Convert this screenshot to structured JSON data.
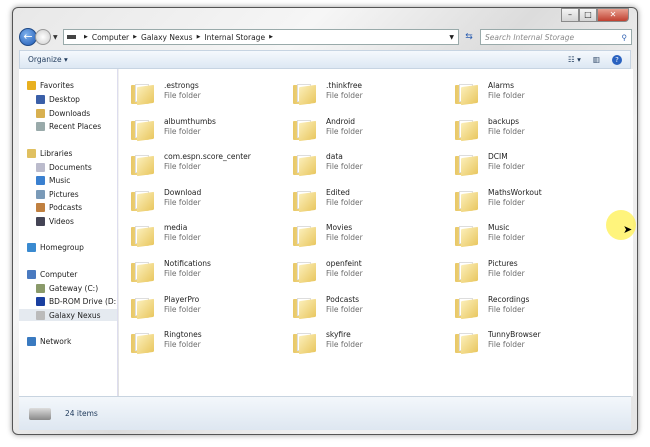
{
  "breadcrumb": [
    "Computer",
    "Galaxy Nexus",
    "Internal Storage"
  ],
  "search": {
    "placeholder": "Search Internal Storage"
  },
  "toolbar": {
    "organize": "Organize ▾"
  },
  "sidebar": [
    {
      "label": "Favorites",
      "icon": "star-icon",
      "color": "#e8b020",
      "level": 0
    },
    {
      "label": "Desktop",
      "icon": "desktop-icon",
      "color": "#3a5fa8",
      "level": 1
    },
    {
      "label": "Downloads",
      "icon": "downloads-icon",
      "color": "#d8b050",
      "level": 1
    },
    {
      "label": "Recent Places",
      "icon": "recent-places-icon",
      "color": "#9aa",
      "level": 1
    },
    {
      "label": "Libraries",
      "icon": "libraries-icon",
      "color": "#e0c060",
      "level": 0
    },
    {
      "label": "Documents",
      "icon": "documents-icon",
      "color": "#bbc",
      "level": 1
    },
    {
      "label": "Music",
      "icon": "music-icon",
      "color": "#3a80d0",
      "level": 1
    },
    {
      "label": "Pictures",
      "icon": "pictures-icon",
      "color": "#7a9ab8",
      "level": 1
    },
    {
      "label": "Podcasts",
      "icon": "podcasts-icon",
      "color": "#c08040",
      "level": 1
    },
    {
      "label": "Videos",
      "icon": "videos-icon",
      "color": "#445",
      "level": 1
    },
    {
      "label": "Homegroup",
      "icon": "homegroup-icon",
      "color": "#3a8ad0",
      "level": 0
    },
    {
      "label": "Computer",
      "icon": "computer-icon",
      "color": "#4a7ac0",
      "level": 0
    },
    {
      "label": "Gateway (C:)",
      "icon": "drive-icon",
      "color": "#8a9a6a",
      "level": 1
    },
    {
      "label": "BD-ROM Drive (D:) E",
      "icon": "bluetooth-icon",
      "color": "#1a3fa0",
      "level": 1
    },
    {
      "label": "Galaxy Nexus",
      "icon": "phone-icon",
      "color": "#bbb",
      "level": 1,
      "selected": true
    },
    {
      "label": "Network",
      "icon": "network-icon",
      "color": "#3a7ac0",
      "level": 0
    }
  ],
  "folders": [
    {
      "name": ".estrongs",
      "type": "File folder"
    },
    {
      "name": ".thinkfree",
      "type": "File folder"
    },
    {
      "name": "Alarms",
      "type": "File folder"
    },
    {
      "name": "albumthumbs",
      "type": "File folder"
    },
    {
      "name": "Android",
      "type": "File folder"
    },
    {
      "name": "backups",
      "type": "File folder"
    },
    {
      "name": "com.espn.score_center",
      "type": "File folder"
    },
    {
      "name": "data",
      "type": "File folder"
    },
    {
      "name": "DCIM",
      "type": "File folder"
    },
    {
      "name": "Download",
      "type": "File folder"
    },
    {
      "name": "Edited",
      "type": "File folder"
    },
    {
      "name": "MathsWorkout",
      "type": "File folder"
    },
    {
      "name": "media",
      "type": "File folder"
    },
    {
      "name": "Movies",
      "type": "File folder"
    },
    {
      "name": "Music",
      "type": "File folder"
    },
    {
      "name": "Notifications",
      "type": "File folder"
    },
    {
      "name": "openfeint",
      "type": "File folder"
    },
    {
      "name": "Pictures",
      "type": "File folder"
    },
    {
      "name": "PlayerPro",
      "type": "File folder"
    },
    {
      "name": "Podcasts",
      "type": "File folder"
    },
    {
      "name": "Recordings",
      "type": "File folder"
    },
    {
      "name": "Ringtones",
      "type": "File folder"
    },
    {
      "name": "skyfire",
      "type": "File folder"
    },
    {
      "name": "TunnyBrowser",
      "type": "File folder"
    }
  ],
  "status": {
    "count": "24 items"
  }
}
